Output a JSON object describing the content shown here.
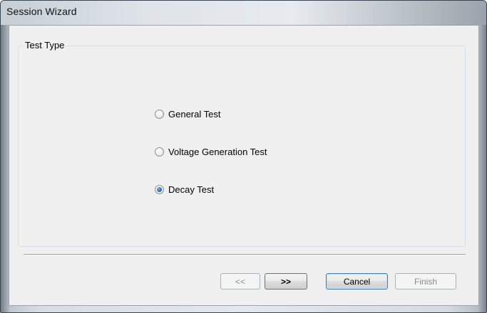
{
  "window": {
    "title": "Session Wizard"
  },
  "test_type": {
    "legend": "Test Type",
    "options": [
      {
        "label": "General Test",
        "selected": false
      },
      {
        "label": "Voltage Generation Test",
        "selected": false
      },
      {
        "label": "Decay Test",
        "selected": true
      }
    ]
  },
  "buttons": {
    "prev": {
      "label": "<<",
      "enabled": false
    },
    "next": {
      "label": ">>",
      "enabled": true
    },
    "cancel": {
      "label": "Cancel",
      "enabled": true
    },
    "finish": {
      "label": "Finish",
      "enabled": false
    }
  },
  "colors": {
    "accent": "#2a6cb3",
    "dialog_background": "#f0f0f0"
  }
}
